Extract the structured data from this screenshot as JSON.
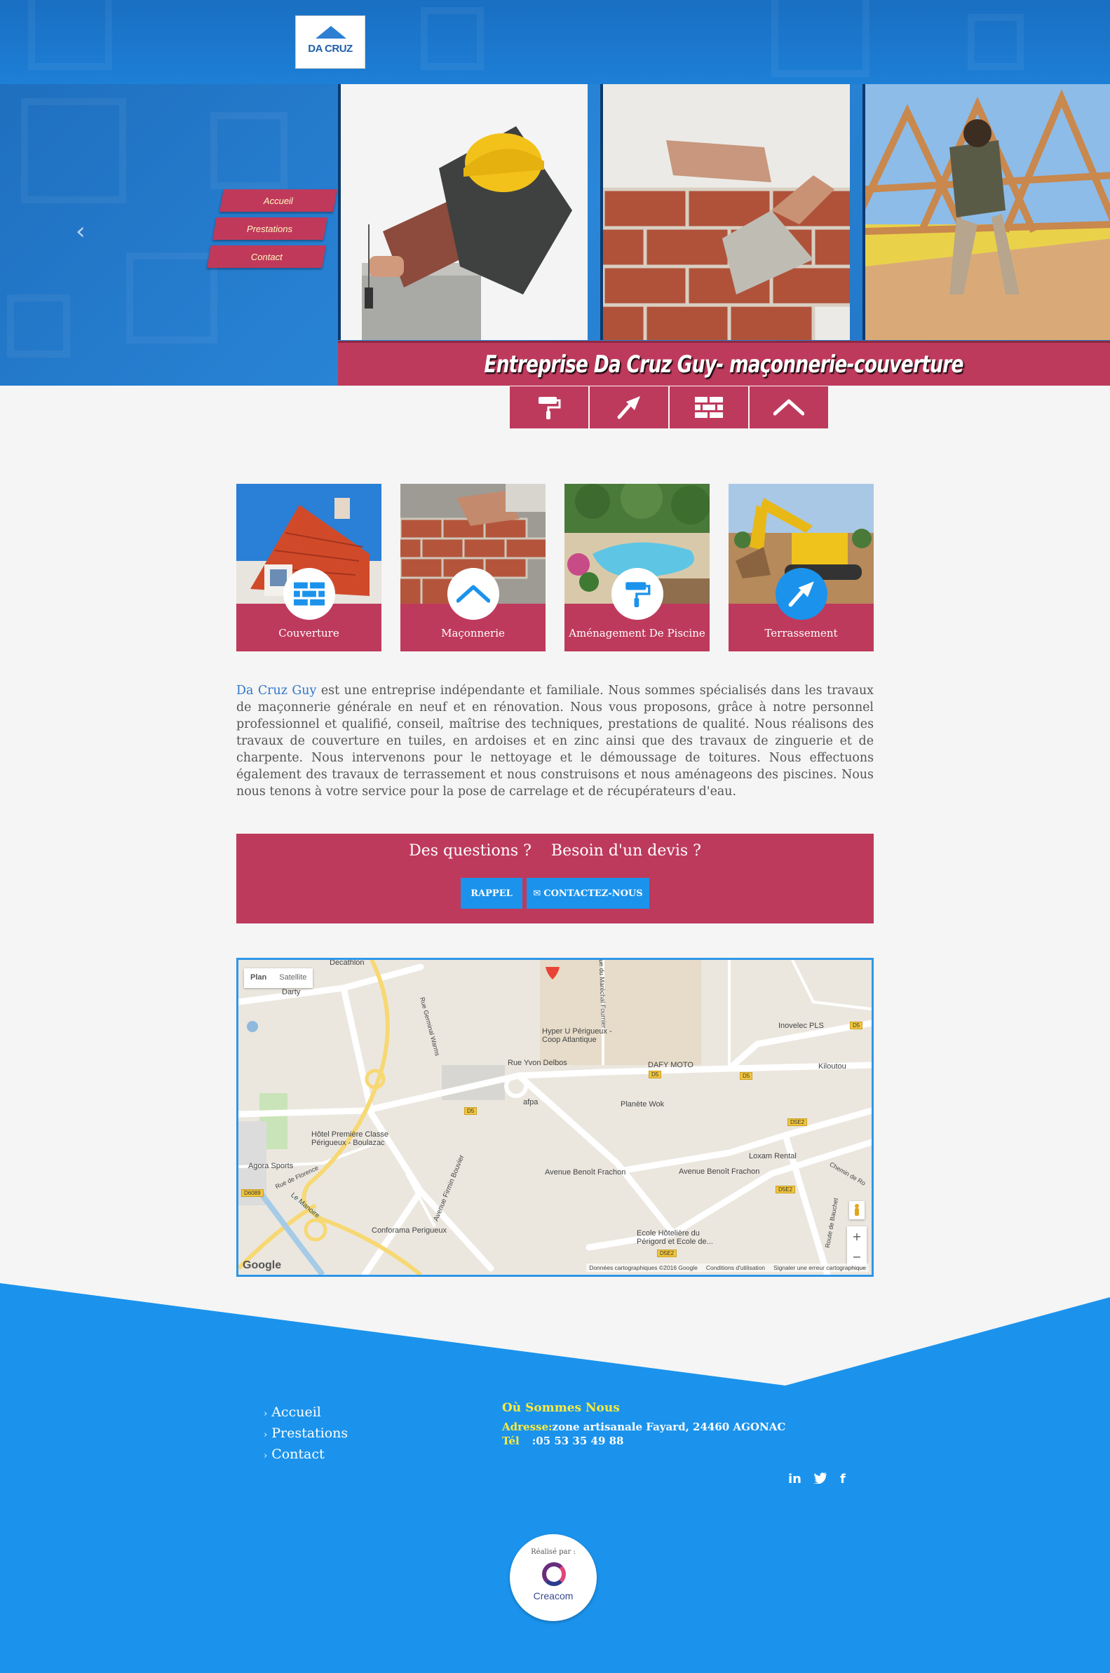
{
  "header": {
    "logo_text": "DA CRUZ",
    "nav": [
      "Accueil",
      "Prestations",
      "Contact"
    ],
    "slider_prev": "‹",
    "banner": "Entreprise Da Cruz Guy- maçonnerie-couverture",
    "icons": [
      "paint-roller-icon",
      "trowel-icon",
      "brick-wall-icon",
      "roof-icon"
    ]
  },
  "services": [
    {
      "label": "Couverture",
      "icon": "brick-wall-icon"
    },
    {
      "label": "Maçonnerie",
      "icon": "roof-icon"
    },
    {
      "label": "Aménagement De Piscine",
      "icon": "paint-roller-icon"
    },
    {
      "label": "Terrassement",
      "icon": "trowel-icon"
    }
  ],
  "intro": {
    "link": "Da Cruz Guy",
    "text": " est une entreprise indépendante et familiale. Nous sommes spécialisés dans les travaux de maçonnerie générale en neuf et en rénovation. Nous vous  proposons, grâce à notre personnel professionnel et qualifié, conseil, maîtrise des techniques, prestations de qualité. Nous réalisons des travaux de couverture en tuiles, en ardoises et en zinc ainsi que des travaux de zinguerie et de charpente. Nous intervenons pour le nettoyage et le démoussage de toitures. Nous effectuons également des travaux de terrassement et nous construisons et nous aménageons des piscines. Nous nous tenons à votre service pour la pose de carrelage et de récupérateurs d'eau."
  },
  "cta": {
    "title": "Des questions ?    Besoin d'un devis ?",
    "btn_rappel": "RAPPEL",
    "btn_contact": "CONTACTEZ-NOUS"
  },
  "map": {
    "tabs": [
      "Plan",
      "Satellite"
    ],
    "labels": [
      "Darty",
      "Decathlon",
      "Hyper U Périgueux - Coop Atlantique",
      "Rue Yvon Delbos",
      "DAFY MOTO",
      "Kiloutou",
      "Inovelec PLS",
      "afpa",
      "Planète Wok",
      "Hôtel Première Classe Périgueux - Boulazac",
      "Agora Sports",
      "Avenue Firmin Bouvier",
      "Avenue Benoît Frachon",
      "Avenue Benoît Frachon",
      "Loxam Rental",
      "Conforama Perigueux",
      "Ecole Hôtelière du Périgord et Ecole de...",
      "Le Manoire",
      "Rue de Florence",
      "Rue Germinal Warms",
      "Chemin de Ro",
      "Route de Bauchet",
      "Rue du Maréchal Fournier"
    ],
    "roads": [
      "D5",
      "D5",
      "D5",
      "D5",
      "D5E2",
      "D5E2",
      "D5E2",
      "D6089"
    ],
    "zoom_in": "+",
    "zoom_out": "−",
    "google": "Google",
    "footer": [
      "Données cartographiques ©2016 Google",
      "Conditions d'utilisation",
      "Signaler une erreur cartographique"
    ]
  },
  "footer": {
    "links": [
      "Accueil",
      "Prestations",
      "Contact"
    ],
    "where_title": "Où Sommes Nous",
    "address_label": "Adresse:",
    "address_value": "zone artisanale Fayard, 24460 AGONAC",
    "tel_label": "Tél",
    "tel_value": ":05 53 35 49 88",
    "social": [
      "in",
      "🐦",
      "f"
    ],
    "made_by_label": "Réalisé par :",
    "made_by_name": "Creacom"
  },
  "colors": {
    "brand_red": "#be3a5c",
    "blue": "#1b93ec",
    "yellow": "#ffeb3b"
  }
}
